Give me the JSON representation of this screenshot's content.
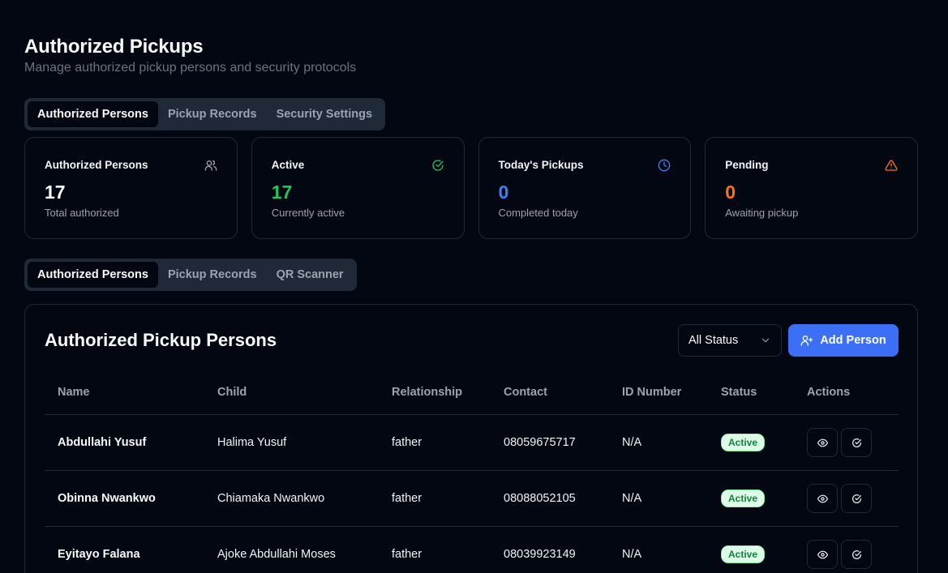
{
  "header": {
    "title": "Authorized Pickups",
    "subtitle": "Manage authorized pickup persons and security protocols"
  },
  "top_tabs": [
    "Authorized Persons",
    "Pickup Records",
    "Security Settings"
  ],
  "stats": [
    {
      "label": "Authorized Persons",
      "value": "17",
      "sub": "Total authorized",
      "icon": "users-icon",
      "color": "#f9fafb"
    },
    {
      "label": "Active",
      "value": "17",
      "sub": "Currently active",
      "icon": "check-circle-icon",
      "color": "#22c55e"
    },
    {
      "label": "Today's Pickups",
      "value": "0",
      "sub": "Completed today",
      "icon": "clock-icon",
      "color": "#3b82f6"
    },
    {
      "label": "Pending",
      "value": "0",
      "sub": "Awaiting pickup",
      "icon": "warning-icon",
      "color": "#f97316"
    }
  ],
  "mid_tabs": [
    "Authorized Persons",
    "Pickup Records",
    "QR Scanner"
  ],
  "panel": {
    "title": "Authorized Pickup Persons",
    "status_filter": "All Status",
    "add_button": "Add Person"
  },
  "table": {
    "columns": [
      "Name",
      "Child",
      "Relationship",
      "Contact",
      "ID Number",
      "Status",
      "Actions"
    ],
    "rows": [
      {
        "name": "Abdullahi Yusuf",
        "child": "Halima Yusuf",
        "relationship": "father",
        "contact": "08059675717",
        "id_number": "N/A",
        "status": "Active"
      },
      {
        "name": "Obinna Nwankwo",
        "child": "Chiamaka Nwankwo",
        "relationship": "father",
        "contact": "08088052105",
        "id_number": "N/A",
        "status": "Active"
      },
      {
        "name": "Eyitayo Falana",
        "child": "Ajoke Abdullahi Moses",
        "relationship": "father",
        "contact": "08039923149",
        "id_number": "N/A",
        "status": "Active"
      }
    ]
  }
}
